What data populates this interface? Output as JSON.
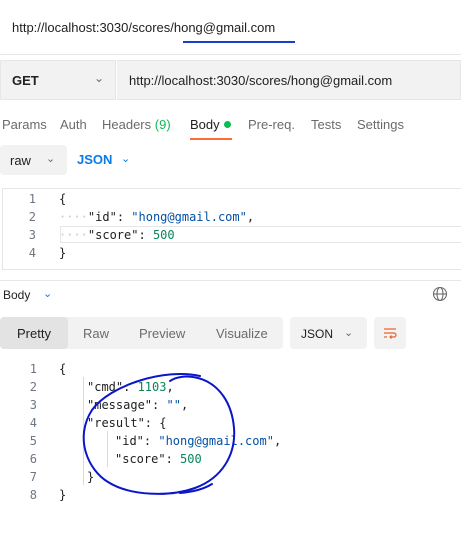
{
  "tab": {
    "title": "http://localhost:3030/scores/hong@gmail.com"
  },
  "request": {
    "method": "GET",
    "url": "http://localhost:3030/scores/hong@gmail.com"
  },
  "request_tabs": {
    "params": "Params",
    "auth": "Auth",
    "headers": "Headers",
    "headers_count": "(9)",
    "body": "Body",
    "prereq": "Pre-req.",
    "tests": "Tests",
    "settings": "Settings"
  },
  "body_mode": {
    "raw": "raw",
    "json": "JSON"
  },
  "request_body": {
    "line_numbers": [
      "1",
      "2",
      "3",
      "4"
    ],
    "open_brace": "{",
    "id_key": "\"id\"",
    "id_value": "\"hong@gmail.com\"",
    "score_key": "\"score\"",
    "score_value": "500",
    "close_brace": "}"
  },
  "response": {
    "title": "Body",
    "views": {
      "pretty": "Pretty",
      "raw": "Raw",
      "preview": "Preview",
      "visualize": "Visualize"
    },
    "format": "JSON",
    "line_numbers": [
      "1",
      "2",
      "3",
      "4",
      "5",
      "6",
      "7",
      "8"
    ],
    "open_brace": "{",
    "cmd_key": "\"cmd\"",
    "cmd_value": "1103",
    "message_key": "\"message\"",
    "message_value": "\"\"",
    "result_key": "\"result\"",
    "result_open": "{",
    "id_key": "\"id\"",
    "id_value": "\"hong@gmail.com\"",
    "score_key": "\"score\"",
    "score_value": "500",
    "result_close": "}",
    "close_brace": "}"
  },
  "colors": {
    "accent_underline": "#1a3ccf",
    "body_tab_underline": "#ff6c37",
    "json_blue": "#097bed",
    "annotation_ink": "#0a16c8"
  },
  "icons": [
    "chevron-down-icon",
    "globe-icon",
    "wrap-lines-icon"
  ]
}
